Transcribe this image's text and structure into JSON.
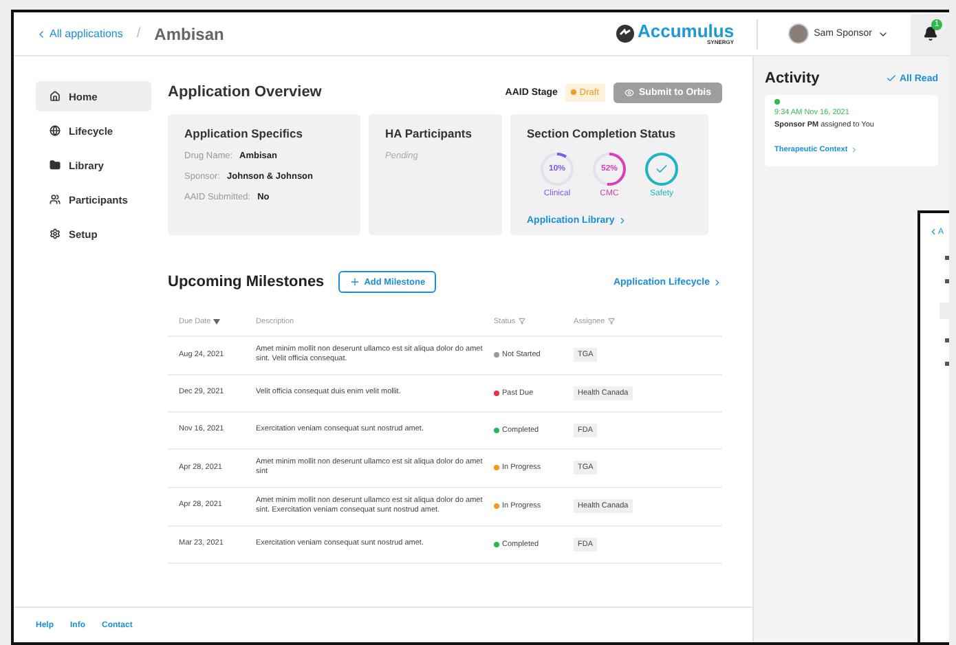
{
  "breadcrumb": {
    "back": "All applications",
    "separator": "/",
    "current": "Ambisan"
  },
  "brand": {
    "name": "Accumulus",
    "sub": "SYNERGY"
  },
  "user": {
    "name": "Sam Sponsor"
  },
  "notifications": {
    "count": "1"
  },
  "sidebar": {
    "items": [
      {
        "label": "Home",
        "selected": true
      },
      {
        "label": "Lifecycle",
        "selected": false
      },
      {
        "label": "Library",
        "selected": false
      },
      {
        "label": "Participants",
        "selected": false
      },
      {
        "label": "Setup",
        "selected": false
      }
    ]
  },
  "overview": {
    "title": "Application Overview",
    "stage_label": "AAID Stage",
    "stage": "Draft",
    "submit_button": {
      "label": "Submit to Orbis",
      "disabled": true
    },
    "specifics": {
      "title": "Application Specifics",
      "fields": [
        {
          "label": "Drug Name:",
          "value": "Ambisan"
        },
        {
          "label": "Sponsor:",
          "value": "Johnson & Johnson"
        },
        {
          "label": "AAID Submitted:",
          "value": "No"
        }
      ]
    },
    "ha_participants": {
      "title": "HA Participants",
      "value": "Pending"
    },
    "completion": {
      "title": "Section Completion Status",
      "items": [
        {
          "kind": "percent",
          "value": "10%",
          "label": "Clinical",
          "level": 0.1,
          "color": "#7b5cf0"
        },
        {
          "kind": "percent",
          "value": "52%",
          "label": "CMC",
          "level": 0.52,
          "color": "#d83fc0"
        },
        {
          "kind": "check",
          "label": "Safety",
          "level": 1,
          "color": "#1eb3c6"
        }
      ],
      "link": "Application Library"
    }
  },
  "milestones": {
    "title": "Upcoming Milestones",
    "add_button": "Add Milestone",
    "link": "Application Lifecycle",
    "columns": [
      {
        "label": "Due Date",
        "kind": "sort"
      },
      {
        "label": "Description",
        "kind": "plain"
      },
      {
        "label": "Status",
        "kind": "filter"
      },
      {
        "label": "Assignee",
        "kind": "filter"
      }
    ],
    "rows": [
      {
        "date": "Aug 24, 2021",
        "description": "Amet minim mollit non deserunt ullamco est sit aliqua dolor do amet sint. Velit officia consequat.",
        "status": "Not Started",
        "color": "#9a9a9a",
        "assignee": "TGA"
      },
      {
        "date": "Dec 29, 2021",
        "description": "Velit officia consequat duis enim velit mollit.",
        "status": "Past Due",
        "color": "#e8304a",
        "assignee": "Health Canada"
      },
      {
        "date": "Nov 16, 2021",
        "description": "Exercitation veniam consequat sunt nostrud amet.",
        "status": "Completed",
        "color": "#2fb84c",
        "assignee": "FDA"
      },
      {
        "date": "Apr 28, 2021",
        "description": "Amet minim mollit non deserunt ullamco est sit aliqua dolor do amet sint",
        "status": "In Progress",
        "color": "#f39a1e",
        "assignee": "TGA"
      },
      {
        "date": "Apr 28, 2021",
        "description": "Amet minim mollit non deserunt ullamco est sit aliqua dolor do amet sint. Exercitation veniam consequat sunt nostrud amet.",
        "status": "In Progress",
        "color": "#f39a1e",
        "assignee": "Health Canada"
      },
      {
        "date": "Mar 23, 2021",
        "description": "Exercitation veniam consequat sunt nostrud amet.",
        "status": "Completed",
        "color": "#2fb84c",
        "assignee": "FDA"
      }
    ]
  },
  "activity": {
    "title": "Activity",
    "mark_read": "All Read",
    "items": [
      {
        "unread": true,
        "time": "9:34 AM Nov 16, 2021",
        "text": "**Sponsor PM** assigned to You",
        "link": "Therapeutic Context"
      }
    ]
  },
  "footer": {
    "links": [
      "Help",
      "Info",
      "Contact"
    ]
  },
  "second_window": {
    "back_link": "A"
  }
}
